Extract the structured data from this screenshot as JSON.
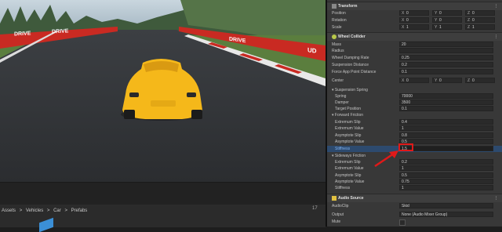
{
  "transform": {
    "header": "Transform",
    "rows": [
      {
        "label": "Position",
        "x": "0",
        "y": "0",
        "z": "0"
      },
      {
        "label": "Rotation",
        "x": "0",
        "y": "0",
        "z": "0"
      },
      {
        "label": "Scale",
        "x": "1",
        "y": "1",
        "z": "1"
      }
    ]
  },
  "wheel_collider": {
    "header": "Wheel Collider",
    "mass": {
      "label": "Mass",
      "value": "20"
    },
    "radius": {
      "label": "Radius",
      "value": ""
    },
    "damping": {
      "label": "Wheel Damping Rate",
      "value": "0.25"
    },
    "suspension_distance": {
      "label": "Suspension Distance",
      "value": "0.2"
    },
    "force_app": {
      "label": "Force App Point Distance",
      "value": "0.1"
    },
    "center": {
      "label": "Center",
      "x": "0",
      "y": "0",
      "z": "0"
    },
    "suspension_spring": {
      "label": "Suspension Spring",
      "spring": {
        "label": "Spring",
        "value": "70000"
      },
      "damper": {
        "label": "Damper",
        "value": "3500"
      },
      "target": {
        "label": "Target Position",
        "value": "0.1"
      }
    },
    "forward_friction": {
      "label": "Forward Friction",
      "extremum_slip": {
        "label": "Extremum Slip",
        "value": "0.4"
      },
      "extremum_value": {
        "label": "Extremum Value",
        "value": "1"
      },
      "asymptote_slip": {
        "label": "Asymptote Slip",
        "value": "0.8"
      },
      "asymptote_value": {
        "label": "Asymptote Value",
        "value": "0.5"
      },
      "stiffness": {
        "label": "Stiffness",
        "value": "1.5"
      }
    },
    "sideways_friction": {
      "label": "Sideways Friction",
      "extremum_slip": {
        "label": "Extremum Slip",
        "value": "0.2"
      },
      "extremum_value": {
        "label": "Extremum Value",
        "value": "1"
      },
      "asymptote_slip": {
        "label": "Asymptote Slip",
        "value": "0.5"
      },
      "asymptote_value": {
        "label": "Asymptote Value",
        "value": "0.75"
      },
      "stiffness": {
        "label": "Stiffness",
        "value": "1"
      }
    }
  },
  "audio_source": {
    "header": "Audio Source",
    "clip": {
      "label": "AudioClip",
      "value": "Skid"
    },
    "output": {
      "label": "Output",
      "value": "None (Audio Mixer Group)"
    },
    "mute": {
      "label": "Mute"
    }
  },
  "project": {
    "breadcrumb": [
      "Assets",
      ">",
      "Vehicles",
      ">",
      "Car",
      ">",
      "Prefabs"
    ],
    "item_count": "17"
  },
  "scene": {
    "barrier_text": "DRIVE",
    "barrier_text_right": "UD"
  },
  "colors": {
    "highlight": "#e01919",
    "car": "#f5b81a",
    "barrier": "#c92a22"
  }
}
